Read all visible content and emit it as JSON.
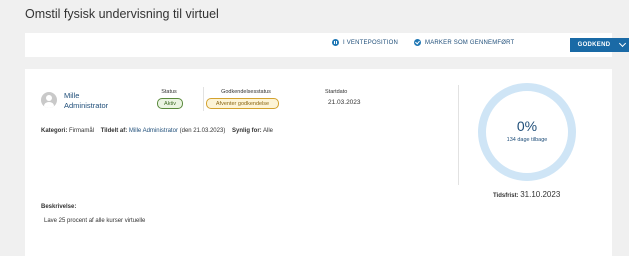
{
  "page": {
    "title": "Omstil fysisk undervisning til virtuel"
  },
  "toolbar": {
    "pause_label": "I VENTEPOSITION",
    "complete_label": "MARKER SOM GENNEMFØRT",
    "approve_label": "GODKEND"
  },
  "assignee": {
    "first_name": "Mille",
    "last_name": "Administrator"
  },
  "columns": {
    "status_label": "Status",
    "status_value": "Aktiv",
    "approval_label": "Godkendelsesstatus",
    "approval_value": "Afventer godkendelse",
    "start_label": "Startdato",
    "start_value": "21.03.2023"
  },
  "meta": {
    "category_label": "Kategori:",
    "category_value": "Firmamål",
    "assigned_by_label": "Tildelt af:",
    "assigned_by_value": "Mille Administrator",
    "assigned_date": "(den 21.03.2023)",
    "visible_label": "Synlig for:",
    "visible_value": "Alle"
  },
  "progress": {
    "percent_text": "0%",
    "percent_value": 0,
    "days_left": "134 dage tilbage"
  },
  "deadline": {
    "label": "Tidsfrist:",
    "value": "31.10.2023"
  },
  "description": {
    "label": "Beskrivelse:",
    "text": "Lave 25 procent af alle kurser virtuelle"
  },
  "colors": {
    "accent": "#1a6aa6",
    "link": "#1f4e79",
    "ring": "#cfe5f6",
    "status_active": "#5a8a3c",
    "status_pending": "#d3a22e"
  },
  "icons": {
    "pause": "pause-circle-icon",
    "complete": "check-circle-icon",
    "approve_menu": "chevron-down-icon",
    "avatar": "user-avatar-icon"
  }
}
